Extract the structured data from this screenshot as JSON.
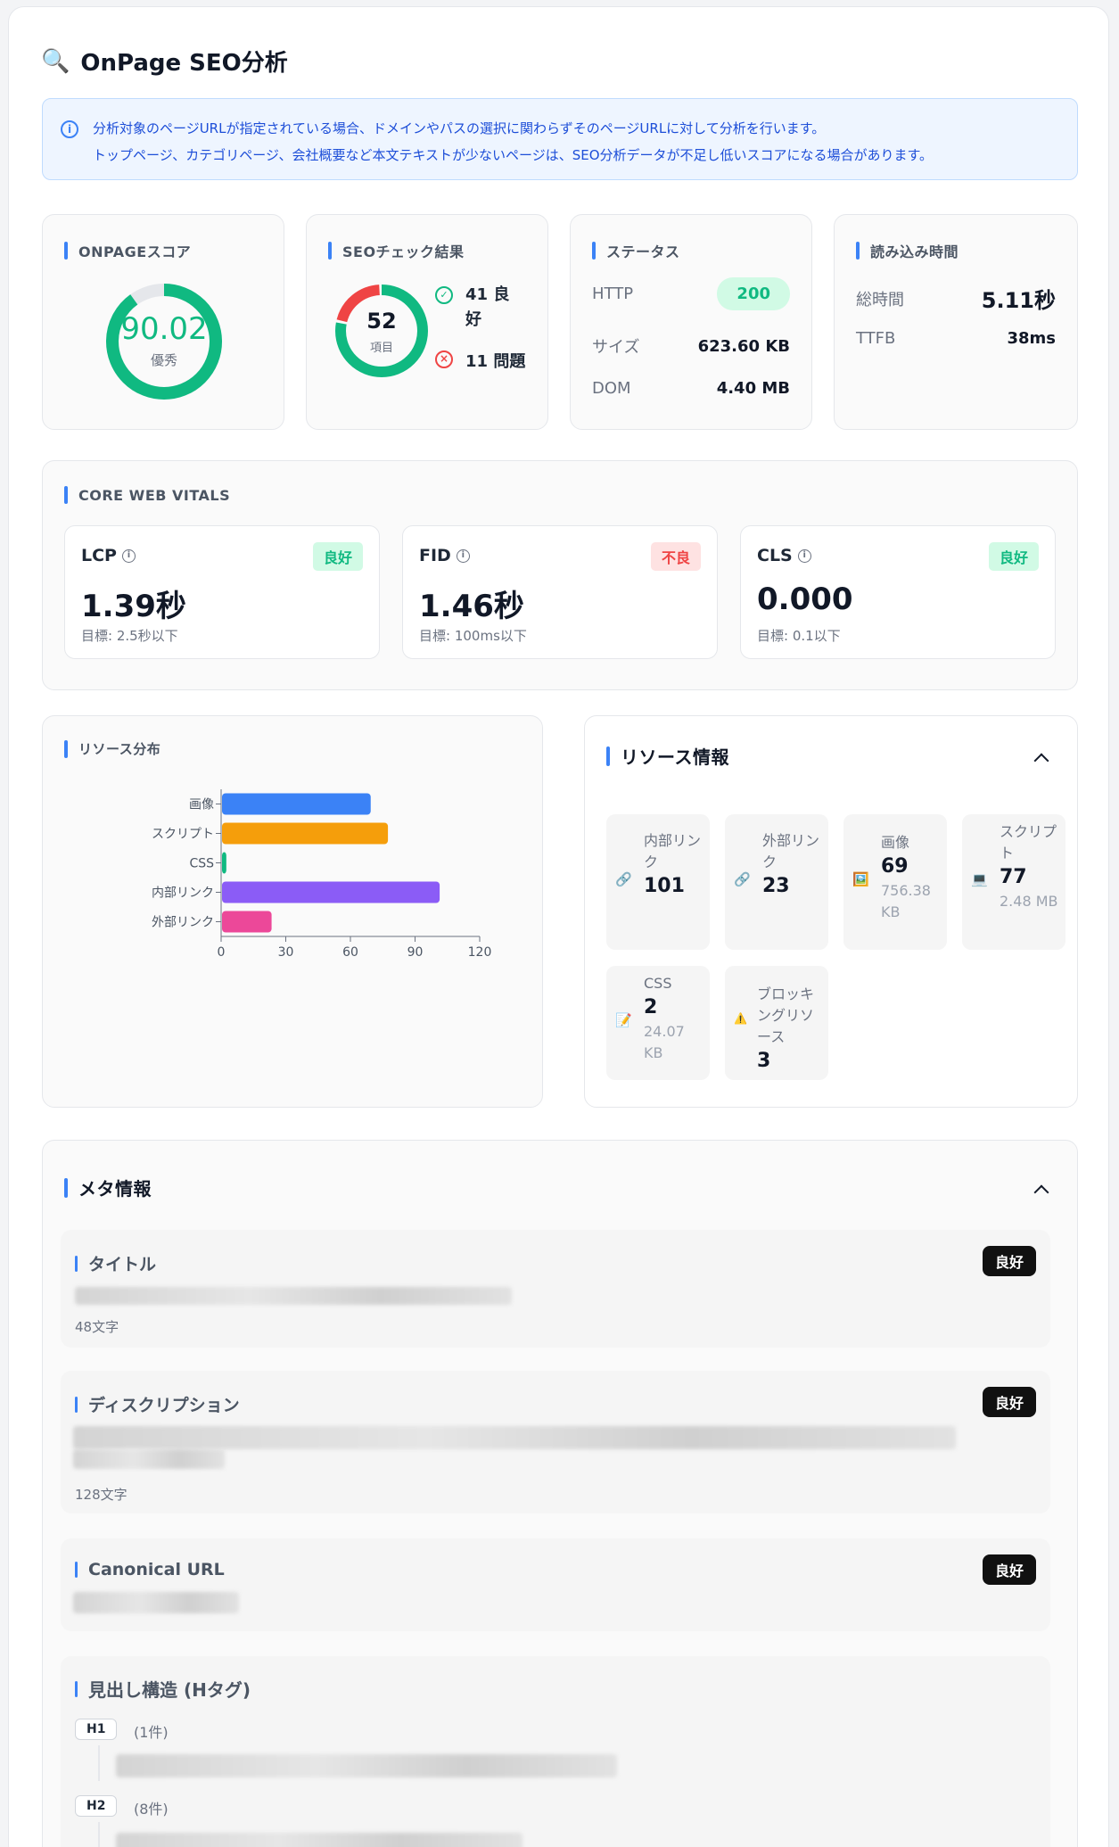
{
  "header": {
    "title": "OnPage SEO分析"
  },
  "notice": {
    "line1": "分析対象のページURLが指定されている場合、ドメインやパスの選択に関わらずそのページURLに対して分析を行います。",
    "line2": "トップページ、カテゴリページ、会社概要など本文テキストが少ないページは、SEO分析データが不足し低いスコアになる場合があります。"
  },
  "score": {
    "label": "ONPAGEスコア",
    "value": "90.02",
    "grade": "優秀",
    "fraction": 0.9002,
    "color": "#10b981"
  },
  "seo_check": {
    "label": "SEOチェック結果",
    "total": "52",
    "unit": "項目",
    "good_count": 41,
    "bad_count": 11,
    "good_text": "41 良好",
    "bad_text": "11 問題",
    "good_color": "#10b981",
    "bad_color": "#ef4444"
  },
  "status": {
    "label": "ステータス",
    "http_label": "HTTP",
    "http_value": "200",
    "size_label": "サイズ",
    "size_value": "623.60 KB",
    "dom_label": "DOM",
    "dom_value": "4.40 MB"
  },
  "load_time": {
    "label": "読み込み時間",
    "total_label": "総時間",
    "total_value": "5.11秒",
    "ttfb_label": "TTFB",
    "ttfb_value": "38ms"
  },
  "cwv": {
    "label": "CORE WEB VITALS",
    "items": [
      {
        "name": "LCP",
        "status": "良好",
        "value": "1.39秒",
        "target": "目標: 2.5秒以下"
      },
      {
        "name": "FID",
        "status": "不良",
        "value": "1.46秒",
        "target": "目標: 100ms以下"
      },
      {
        "name": "CLS",
        "status": "良好",
        "value": "0.000",
        "target": "目標: 0.1以下"
      }
    ]
  },
  "chart_data": {
    "type": "bar",
    "orientation": "horizontal",
    "title": "リソース分布",
    "categories": [
      "画像",
      "スクリプト",
      "CSS",
      "内部リンク",
      "外部リンク"
    ],
    "values": [
      69,
      77,
      2,
      101,
      23
    ],
    "colors": [
      "#3b82f6",
      "#f59e0b",
      "#10b981",
      "#8b5cf6",
      "#ec4899"
    ],
    "xlim": [
      0,
      120
    ],
    "xticks": [
      "0",
      "30",
      "60",
      "90",
      "120"
    ]
  },
  "resource_info": {
    "label": "リソース情報",
    "tiles": [
      {
        "icon": "link-icon",
        "glyph": "🔗",
        "label": "内部リンク",
        "value": "101",
        "sub": ""
      },
      {
        "icon": "link-icon",
        "glyph": "🔗",
        "label": "外部リンク",
        "value": "23",
        "sub": ""
      },
      {
        "icon": "image-icon",
        "glyph": "🖼️",
        "label": "画像",
        "value": "69",
        "sub": "756.38 KB"
      },
      {
        "icon": "laptop-icon",
        "glyph": "💻",
        "label": "スクリプト",
        "value": "77",
        "sub": "2.48 MB"
      },
      {
        "icon": "memo-icon",
        "glyph": "📝",
        "label": "CSS",
        "value": "2",
        "sub": "24.07 KB"
      },
      {
        "icon": "warning-icon",
        "glyph": "⚠️",
        "label": "ブロッキングリソース",
        "value": "3",
        "sub": ""
      }
    ]
  },
  "meta": {
    "label": "メタ情報",
    "title_label": "タイトル",
    "title_status": "良好",
    "title_count": "48文字",
    "desc_label": "ディスクリプション",
    "desc_status": "良好",
    "desc_count": "128文字",
    "canonical_label": "Canonical URL",
    "canonical_status": "良好",
    "headings_label": "見出し構造 (Hタグ)",
    "h1_tag": "H1",
    "h1_count": "(1件)",
    "h2_tag": "H2",
    "h2_count": "(8件)"
  }
}
